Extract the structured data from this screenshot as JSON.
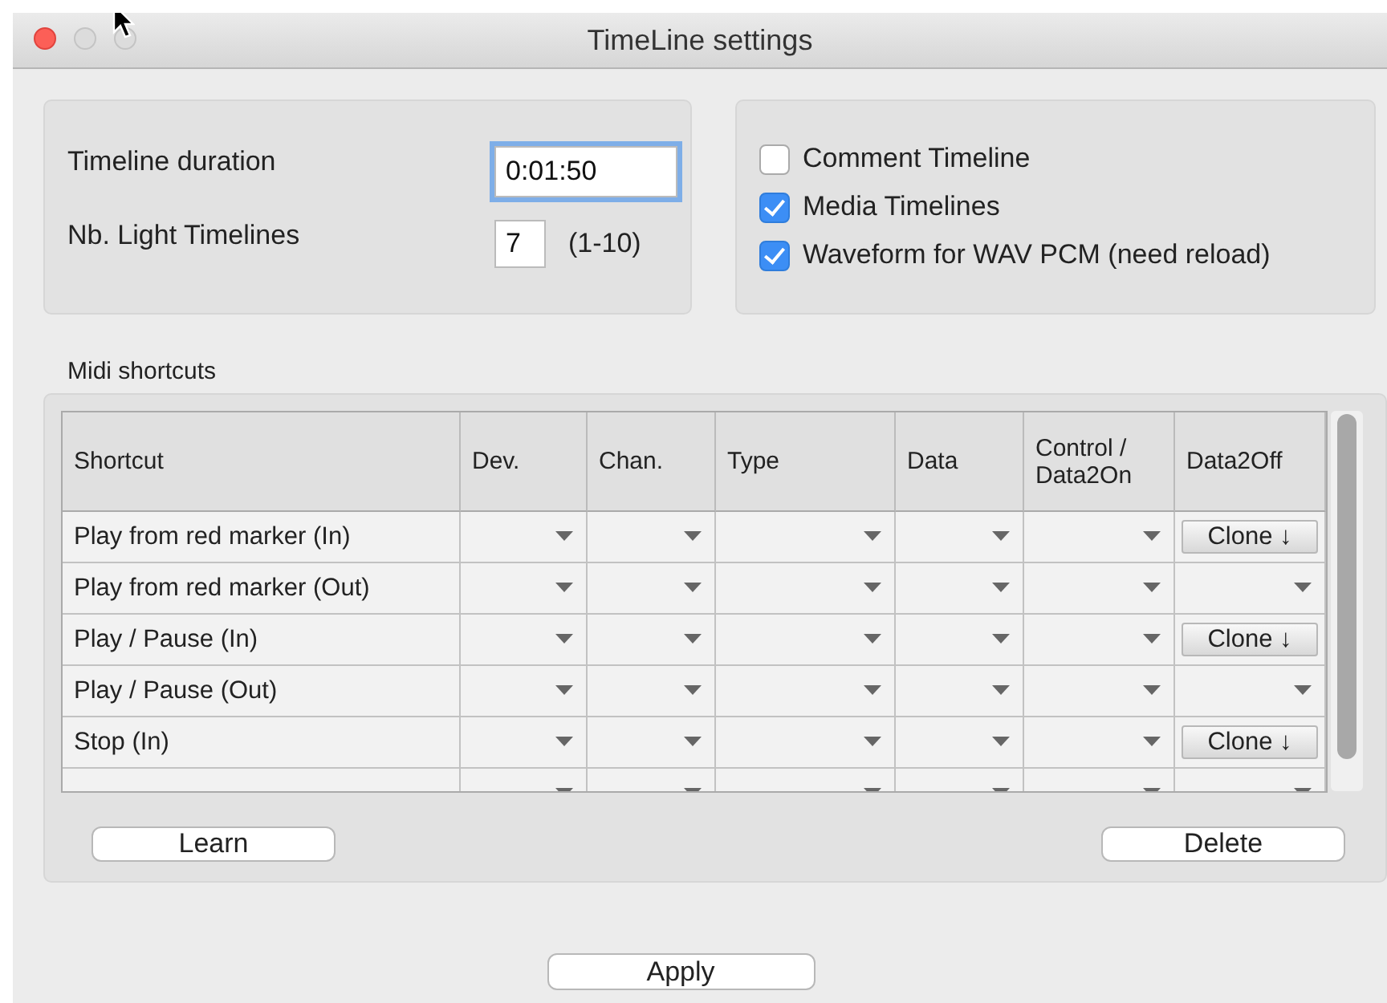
{
  "window": {
    "title": "TimeLine settings"
  },
  "duration": {
    "label": "Timeline duration",
    "value": "0:01:50",
    "focused": true
  },
  "light_timelines": {
    "label": "Nb. Light Timelines",
    "value": "7",
    "range": "(1-10)"
  },
  "options": [
    {
      "label": "Comment Timeline",
      "checked": false
    },
    {
      "label": "Media Timelines",
      "checked": true
    },
    {
      "label": "Waveform for WAV PCM (need reload)",
      "checked": true
    }
  ],
  "midi": {
    "title": "Midi shortcuts",
    "columns": [
      "Shortcut",
      "Dev.",
      "Chan.",
      "Type",
      "Data",
      "Control / Data2On",
      "Data2Off"
    ],
    "rows": [
      {
        "shortcut": "Play from red marker (In)",
        "data2off": {
          "kind": "clone",
          "label": "Clone ↓"
        }
      },
      {
        "shortcut": "Play from red marker (Out)",
        "data2off": {
          "kind": "dropdown"
        }
      },
      {
        "shortcut": "Play / Pause (In)",
        "data2off": {
          "kind": "clone",
          "label": "Clone ↓"
        }
      },
      {
        "shortcut": "Play / Pause (Out)",
        "data2off": {
          "kind": "dropdown"
        }
      },
      {
        "shortcut": "Stop (In)",
        "data2off": {
          "kind": "clone",
          "label": "Clone ↓"
        }
      },
      {
        "data2off": {
          "kind": "dropdown"
        }
      }
    ],
    "buttons": [
      "Learn",
      "Delete"
    ]
  },
  "apply_button": "Apply"
}
